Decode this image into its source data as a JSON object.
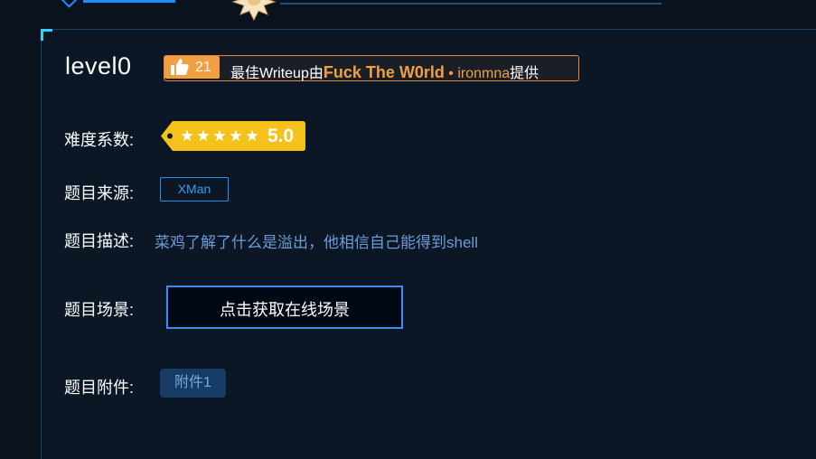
{
  "challenge": {
    "title": "level0",
    "writeup": {
      "likes": "21",
      "prefix": "最佳Writeup由",
      "author_name": "Fuck The W0rld",
      "separator": " • ",
      "author_user": "ironmna",
      "suffix": "提供",
      "accent_color": "#f0a040"
    },
    "difficulty": {
      "label": "难度系数:",
      "stars": 5,
      "score": "5.0",
      "tag_color": "#f5c21b"
    },
    "source": {
      "label": "题目来源:",
      "value": "XMan"
    },
    "description": {
      "label": "题目描述:",
      "text": "菜鸡了解了什么是溢出，他相信自己能得到shell"
    },
    "scene": {
      "label": "题目场景:",
      "button_label": "点击获取在线场景"
    },
    "attachment": {
      "label": "题目附件:",
      "button_label": "附件1"
    }
  },
  "icons": [
    "thumbs-up-icon",
    "star-icon",
    "medal-icon"
  ]
}
